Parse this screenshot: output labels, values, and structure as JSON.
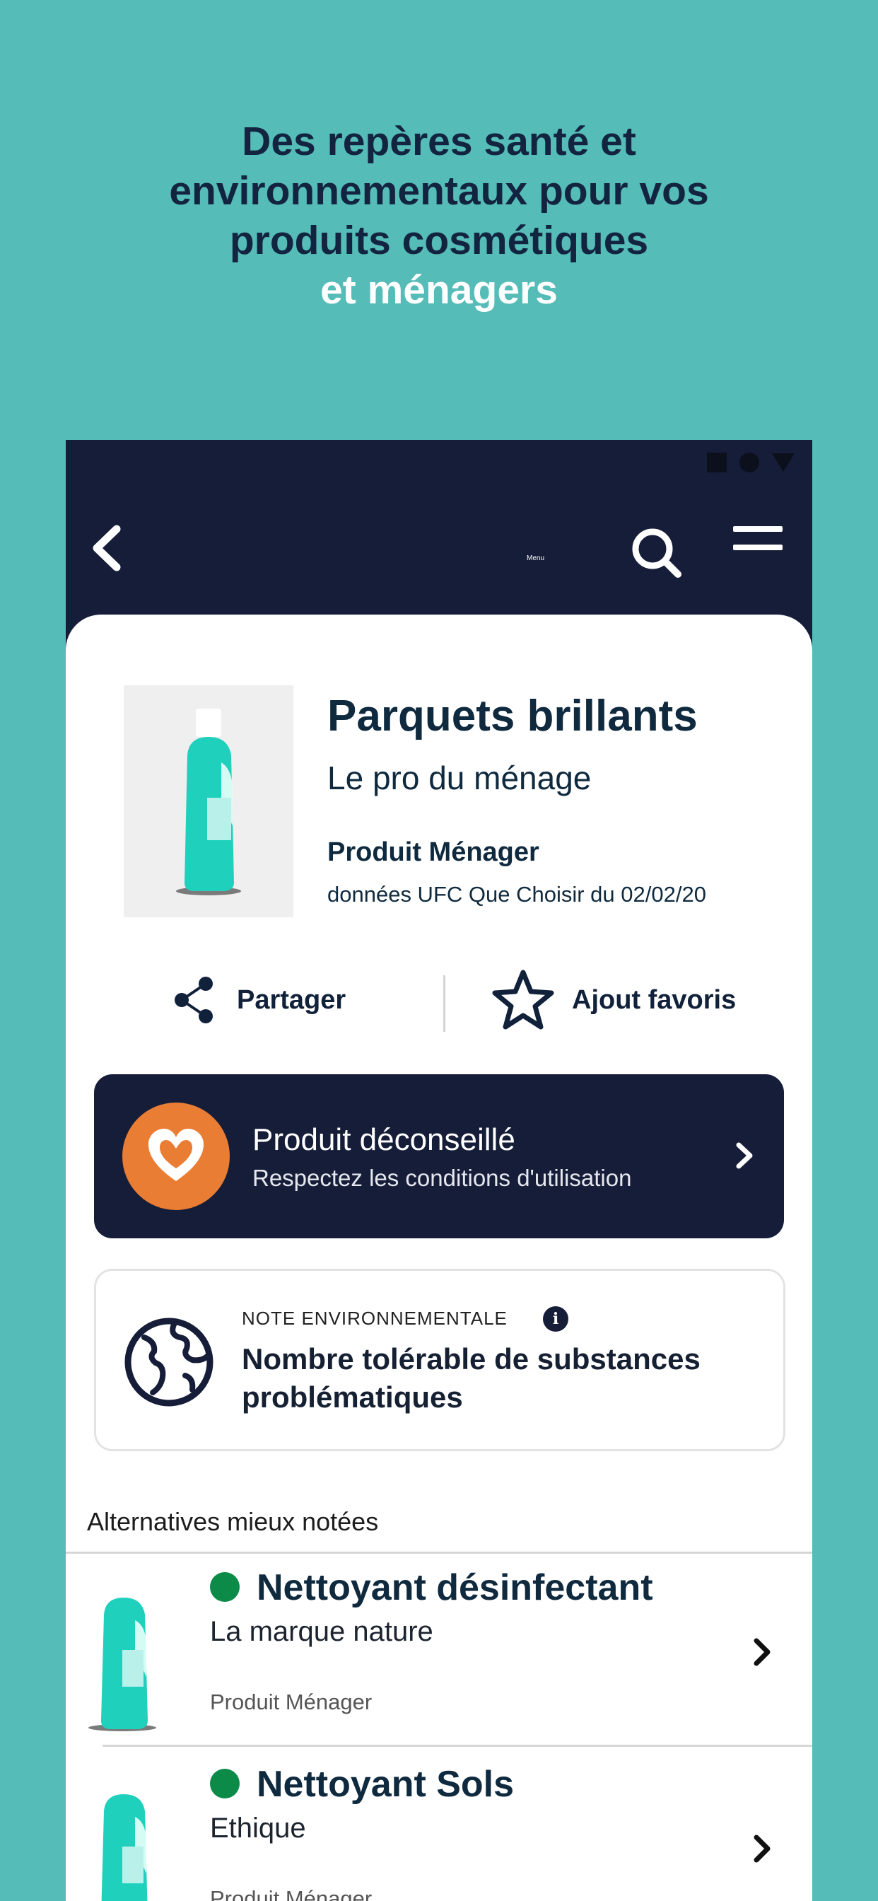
{
  "headline": {
    "line1": "Des repères santé et",
    "line2": "environnementaux pour vos",
    "line3": "produits cosmétiques",
    "line4": "et ménagers"
  },
  "colors": {
    "background": "#55bcb7",
    "navy": "#161d38",
    "orange": "#ea7d34",
    "green": "#0b8a48",
    "product_teal": "#1fd0bd"
  },
  "topbar": {
    "menu_label": "Menu",
    "icons": [
      "back-arrow-icon",
      "search-icon",
      "hamburger-menu-icon"
    ]
  },
  "product": {
    "title": "Parquets brillants",
    "brand": "Le pro du ménage",
    "category": "Produit Ménager",
    "source": "données UFC Que Choisir du 02/02/20"
  },
  "actions": {
    "share_label": "Partager",
    "favorite_label": "Ajout favoris"
  },
  "health_rating": {
    "title": "Produit déconseillé",
    "subtitle": "Respectez les conditions d'utilisation"
  },
  "environment": {
    "label": "NOTE ENVIRONNEMENTALE",
    "info_symbol": "i",
    "text": "Nombre tolérable de substances problématiques"
  },
  "alternatives": {
    "header": "Alternatives mieux notées",
    "items": [
      {
        "name": "Nettoyant désinfectant",
        "brand": "La marque nature",
        "category": "Produit Ménager"
      },
      {
        "name": "Nettoyant Sols",
        "brand": "Ethique",
        "category": "Produit Ménager"
      }
    ]
  }
}
